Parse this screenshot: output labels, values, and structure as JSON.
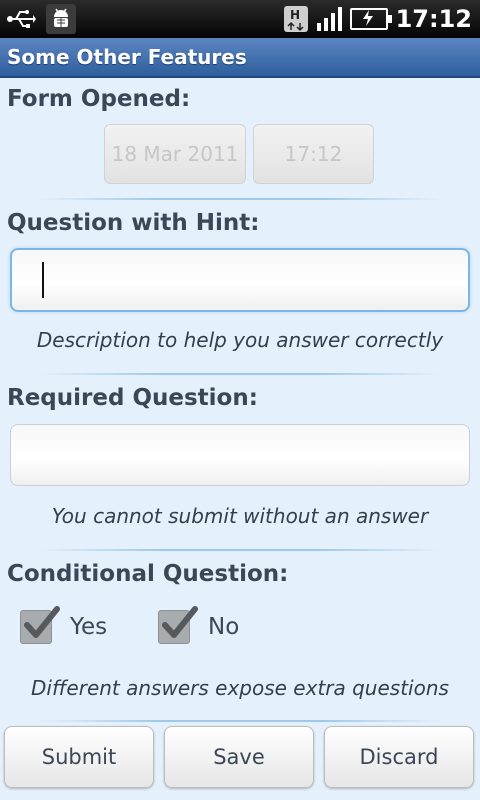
{
  "status_bar": {
    "time": "17:12",
    "network_badge": "H",
    "icons": [
      "usb-icon",
      "android-debug-icon",
      "hsdpa-icon",
      "signal-icon",
      "battery-charging-icon"
    ]
  },
  "title_bar": {
    "title": "Some Other Features"
  },
  "form": {
    "form_opened": {
      "label": "Form Opened:",
      "date_value": "18 Mar 2011",
      "time_value": "17:12"
    },
    "question_hint": {
      "label": "Question with Hint:",
      "value": "",
      "hint": "Description to help you answer correctly"
    },
    "required_question": {
      "label": "Required Question:",
      "value": "",
      "hint": "You cannot submit without an answer"
    },
    "conditional_question": {
      "label": "Conditional Question:",
      "options": [
        {
          "label": "Yes",
          "checked": true
        },
        {
          "label": "No",
          "checked": true
        }
      ],
      "hint": "Different answers expose extra questions"
    }
  },
  "buttons": {
    "submit": "Submit",
    "save": "Save",
    "discard": "Discard"
  },
  "colors": {
    "background": "#e4f0fb",
    "title_bar": "#3f6eae",
    "label_text": "#3b4756",
    "focus_border": "#7db5e4"
  }
}
